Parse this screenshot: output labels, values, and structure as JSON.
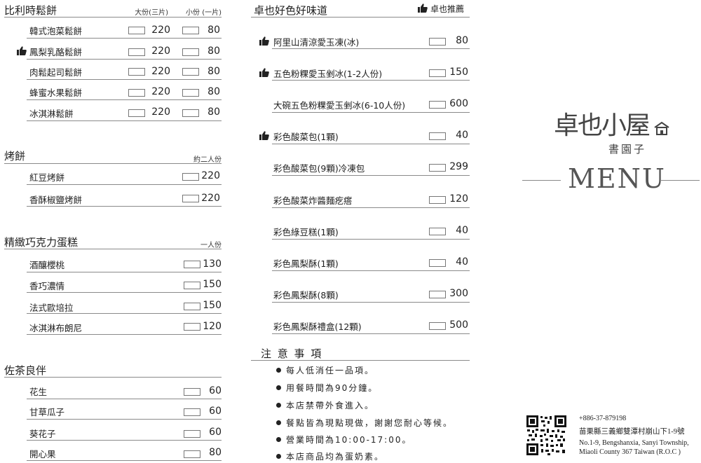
{
  "col1": {
    "s1": {
      "title": "比利時鬆餅",
      "sub_a": "大份(三片)",
      "sub_b": "小份 (一片)",
      "items": [
        {
          "name": "韓式泡菜鬆餅",
          "p1": "220",
          "p2": "80",
          "rec": false
        },
        {
          "name": "鳳梨乳酪鬆餅",
          "p1": "220",
          "p2": "80",
          "rec": true
        },
        {
          "name": "肉鬆起司鬆餅",
          "p1": "220",
          "p2": "80",
          "rec": false
        },
        {
          "name": "蜂蜜水果鬆餅",
          "p1": "220",
          "p2": "80",
          "rec": false
        },
        {
          "name": "冰淇淋鬆餅",
          "p1": "220",
          "p2": "80",
          "rec": false
        }
      ]
    },
    "s2": {
      "title": "烤餅",
      "sub": "約二人份",
      "items": [
        {
          "name": "紅豆烤餅",
          "price": "220"
        },
        {
          "name": "香酥椒鹽烤餅",
          "price": "220"
        }
      ]
    },
    "s3": {
      "title": "精緻巧克力蛋糕",
      "sub": "一人份",
      "items": [
        {
          "name": "酒釀櫻桃",
          "price": "130"
        },
        {
          "name": "香巧濃情",
          "price": "150"
        },
        {
          "name": "法式歐培拉",
          "price": "150"
        },
        {
          "name": "冰淇淋布朗尼",
          "price": "120"
        }
      ]
    },
    "s4": {
      "title": "佐茶良伴",
      "items": [
        {
          "name": "花生",
          "price": "60"
        },
        {
          "name": "甘草瓜子",
          "price": "60"
        },
        {
          "name": "葵花子",
          "price": "60"
        },
        {
          "name": "開心果",
          "price": "80"
        }
      ]
    }
  },
  "col2": {
    "title": "卓也好色好味道",
    "rec_label": "卓也推薦",
    "items": [
      {
        "name": "阿里山清涼愛玉凍(冰)",
        "price": "80",
        "rec": true
      },
      {
        "name": "五色粉粿愛玉剉冰(1-2人份)",
        "price": "150",
        "rec": true
      },
      {
        "name": "大碗五色粉粿愛玉剉冰(6-10人份)",
        "price": "600",
        "rec": false
      },
      {
        "name": "彩色酸菜包(1顆)",
        "price": "40",
        "rec": true
      },
      {
        "name": "彩色酸菜包(9顆)冷凍包",
        "price": "299",
        "rec": false
      },
      {
        "name": "彩色酸菜炸醬麵疙瘩",
        "price": "120",
        "rec": false
      },
      {
        "name": "彩色綠豆糕(1顆)",
        "price": "40",
        "rec": false
      },
      {
        "name": "彩色鳳梨酥(1顆)",
        "price": "40",
        "rec": false
      },
      {
        "name": "彩色鳳梨酥(8顆)",
        "price": "300",
        "rec": false
      },
      {
        "name": "彩色鳳梨酥禮盒(12顆)",
        "price": "500",
        "rec": false
      }
    ],
    "notes_title": "注 意 事 項",
    "notes": [
      "每人低消任一品項。",
      "用餐時間為90分鐘。",
      "本店禁帶外食進入。",
      "餐點皆為現點現做，謝謝您耐心等候。",
      "營業時間為10:00-17:00。",
      "本店商品均為蛋奶素。"
    ]
  },
  "brand": {
    "logo_main": "卓也小屋",
    "logo_sub": "書園子",
    "menu_word": "MENU"
  },
  "footer": {
    "phone": "+886-37-879198",
    "address_zh": "苗栗縣三義鄉雙潭村崩山下1-9號",
    "address_en1": "No.1-9, Bengshanxia, Sanyi Township,",
    "address_en2": "Miaoli County 367  Taiwan (R.O.C )"
  }
}
